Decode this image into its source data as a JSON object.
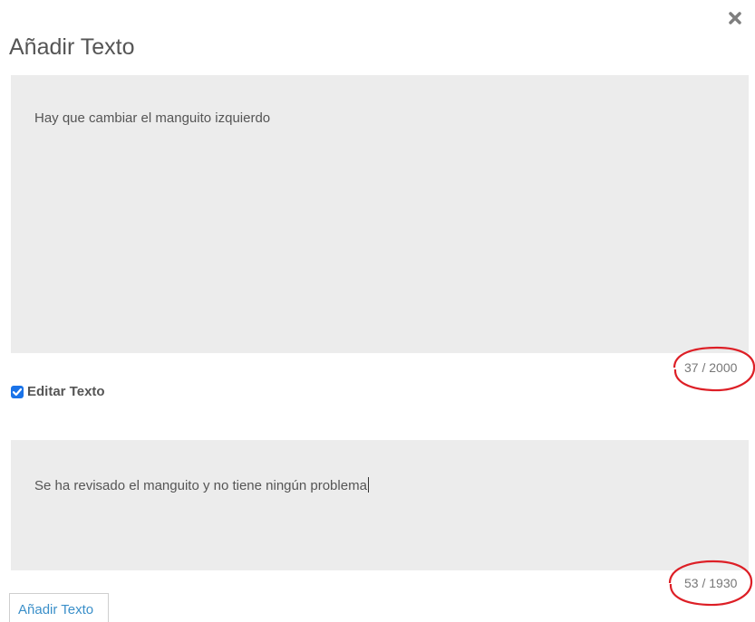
{
  "dialog": {
    "title": "Añadir Texto",
    "close_icon": "close-icon"
  },
  "main_text": {
    "value": "Hay que cambiar el manguito izquierdo",
    "counter": "37 / 2000"
  },
  "edit_checkbox": {
    "label": "Editar Texto",
    "checked": true
  },
  "edit_text": {
    "value": "Se ha revisado el manguito y no tiene ningún problema",
    "counter": "53 / 1930"
  },
  "add_button": {
    "label": "Añadir Texto"
  },
  "colors": {
    "highlight_ellipse": "#dd1f26",
    "textarea_bg": "#ececec",
    "link_blue": "#3a8fc9",
    "checkbox_blue": "#1a73e8"
  }
}
